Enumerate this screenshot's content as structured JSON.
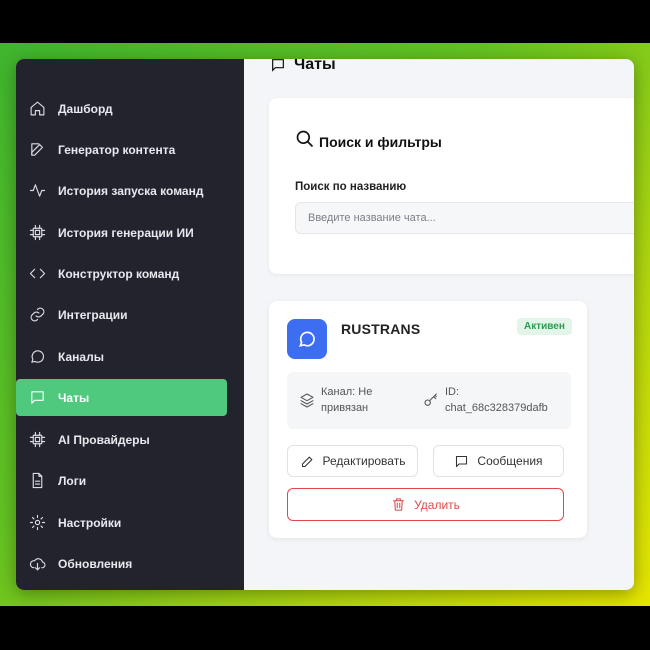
{
  "sidebar": {
    "items": [
      {
        "label": "Дашборд",
        "icon": "home-icon"
      },
      {
        "label": "Генератор контента",
        "icon": "edit-icon"
      },
      {
        "label": "История запуска команд",
        "icon": "activity-icon"
      },
      {
        "label": "История генерации ИИ",
        "icon": "cpu-icon"
      },
      {
        "label": "Конструктор команд",
        "icon": "code-icon"
      },
      {
        "label": "Интеграции",
        "icon": "link-icon"
      },
      {
        "label": "Каналы",
        "icon": "message-circle-icon"
      },
      {
        "label": "Чаты",
        "icon": "message-square-icon",
        "active": true
      },
      {
        "label": "AI Провайдеры",
        "icon": "cpu-icon"
      },
      {
        "label": "Логи",
        "icon": "file-text-icon"
      },
      {
        "label": "Настройки",
        "icon": "settings-icon"
      },
      {
        "label": "Обновления",
        "icon": "cloud-download-icon"
      }
    ],
    "active_color": "#4ec97e",
    "background_color": "#22232c"
  },
  "page": {
    "title": "Чаты"
  },
  "filters": {
    "title": "Поиск и фильтры",
    "search_label": "Поиск по названию",
    "search_placeholder": "Введите название чата...",
    "search_value": ""
  },
  "chat_card": {
    "name": "RUSTRANS",
    "status": "Активен",
    "status_color": "#2b9a52",
    "channel_label": "Канал: Не",
    "channel_value": "привязан",
    "id_label": "ID:",
    "id_value": "chat_68c328379dafb",
    "edit_button": "Редактировать",
    "messages_button": "Сообщения",
    "delete_button": "Удалить",
    "avatar_color": "#3d6ef2",
    "danger_color": "#e34848"
  }
}
